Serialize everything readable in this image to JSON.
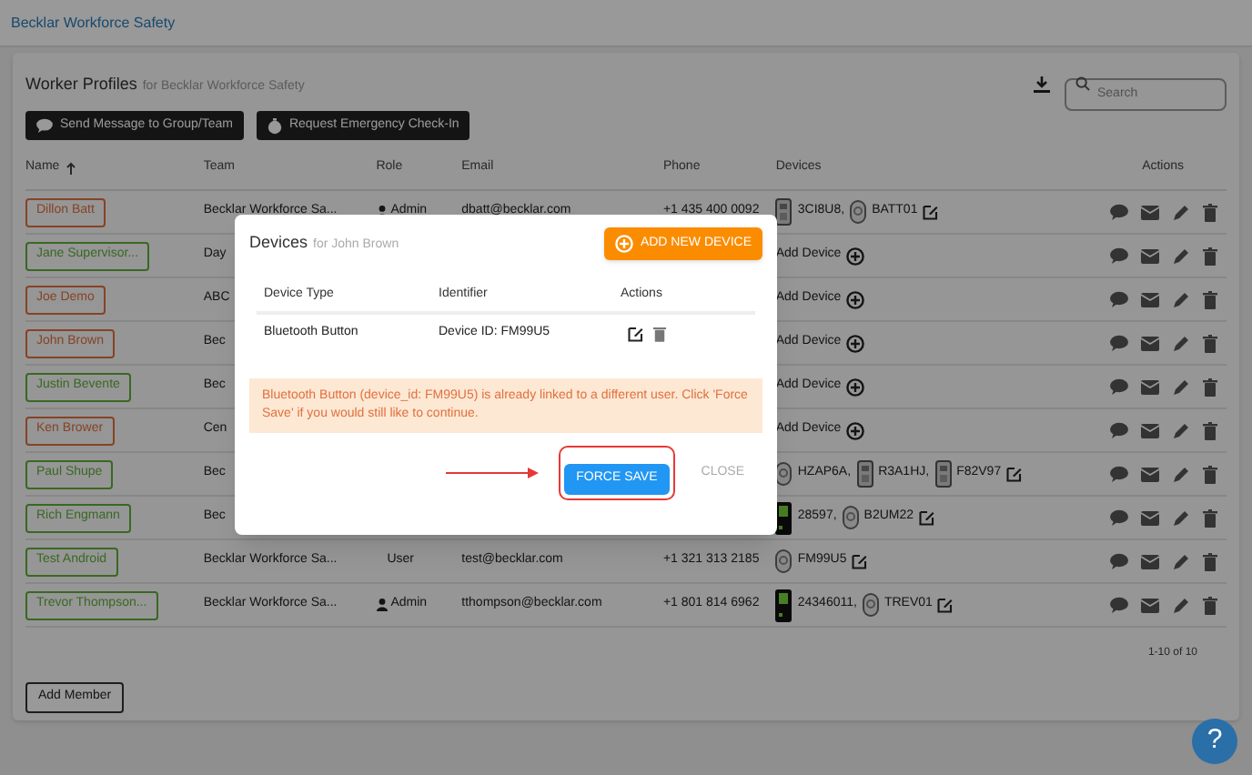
{
  "header": {
    "title": "Becklar Workforce Safety"
  },
  "panel": {
    "title": "Worker Profiles",
    "subtitle": "for Becklar Workforce Safety",
    "search": {
      "placeholder": "Search"
    },
    "buttons": [
      "Send Message to Group/Team",
      "Request Emergency Check-In"
    ]
  },
  "table": {
    "columns": [
      "Name",
      "Team",
      "Role",
      "Email",
      "Phone",
      "Devices",
      "Actions"
    ],
    "rows": [
      {
        "name": "Dillon Batt",
        "color": "#864325",
        "team": "Becklar Workforce Sa...",
        "role": "Admin",
        "role_icon": true,
        "email": "dbatt@becklar.com",
        "phone": "+1 435 400 0092",
        "devices": [
          {
            "kind": "pager",
            "id": "3CI8U8,"
          },
          {
            "kind": "button",
            "id": "BATT01"
          }
        ]
      },
      {
        "name": "Jane Supervisor...",
        "color": "#396823",
        "team": "Day",
        "add_device": "Add Device",
        "devices": []
      },
      {
        "name": "Joe Demo",
        "color": "#864325",
        "team": "ABC",
        "add_device": "Add Device",
        "devices": []
      },
      {
        "name": "John Brown",
        "color": "#864325",
        "team": "Bec",
        "add_device": "Add Device",
        "devices": []
      },
      {
        "name": "Justin Bevente",
        "color": "#396823",
        "team": "Bec",
        "add_device": "Add Device",
        "devices": []
      },
      {
        "name": "Ken Brower",
        "color": "#864325",
        "team": "Cen",
        "add_device": "Add Device",
        "devices": []
      },
      {
        "name": "Paul Shupe",
        "color": "#396823",
        "team": "Bec",
        "devices": [
          {
            "kind": "button",
            "id": "HZAP6A,"
          },
          {
            "kind": "pager",
            "id": "R3A1HJ,"
          },
          {
            "kind": "pager",
            "id": "F82V97"
          }
        ]
      },
      {
        "name": "Rich Engmann",
        "color": "#396823",
        "team": "Bec",
        "devices": [
          {
            "kind": "phone",
            "id": "28597,"
          },
          {
            "kind": "button",
            "id": "B2UM22"
          }
        ]
      },
      {
        "name": "Test Android",
        "color": "#396823",
        "team": "Becklar Workforce Sa...",
        "role": "User",
        "role_icon": false,
        "email": "test@becklar.com",
        "phone": "+1 321 313 2185",
        "devices": [
          {
            "kind": "button",
            "id": "FM99U5"
          }
        ]
      },
      {
        "name": "Trevor Thompson...",
        "color": "#396823",
        "team": "Becklar Workforce Sa...",
        "role": "Admin",
        "role_icon": true,
        "email": "tthompson@becklar.com",
        "phone": "+1 801 814 6962",
        "devices": [
          {
            "kind": "phone",
            "id": "24346011,"
          },
          {
            "kind": "button",
            "id": "TREV01"
          }
        ]
      }
    ],
    "pagination": "1-10 of 10"
  },
  "add_member": "Add Member",
  "help": "?",
  "dialog": {
    "title": "Devices",
    "subtitle": "for John Brown",
    "add_button": "ADD NEW DEVICE",
    "columns": [
      "Device Type",
      "Identifier",
      "Actions"
    ],
    "rows": [
      {
        "type": "Bluetooth Button",
        "identifier": "Device ID: FM99U5"
      }
    ],
    "warning": "Bluetooth Button (device_id: FM99U5) is already linked to a different user. Click 'Force Save' if you would still like to continue.",
    "buttons": [
      {
        "label": "FORCE SAVE",
        "kind": "primary"
      },
      {
        "label": "CLOSE",
        "kind": "text"
      }
    ]
  }
}
